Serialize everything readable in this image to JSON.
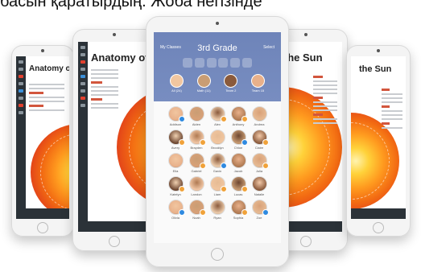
{
  "caption": "басын қаратырдың. Жоба негізінде",
  "left_book": {
    "title": "Anatomy of the"
  },
  "right_book": {
    "title": "of the Sun"
  },
  "far_left_book": {
    "title": "Anatomy of the"
  },
  "far_right_book": {
    "title": "the Sun"
  },
  "class_app": {
    "back": "My Classes",
    "title": "3rd Grade",
    "select": "Select",
    "groups": [
      "All (24)",
      "Math (11)",
      "Team 2",
      "Team 15"
    ],
    "students": [
      "Addison",
      "Aiden",
      "Alex",
      "Anthony",
      "Andrea",
      "Avery",
      "Brayden",
      "Brooklyn",
      "Chloe",
      "Claire",
      "Ella",
      "Gabriel",
      "Gavin",
      "Jacob",
      "Julia",
      "Katelyn",
      "Landon",
      "Liam",
      "Lucas",
      "Natalie",
      "Olivia",
      "Noah",
      "Ryan",
      "Sophia",
      "Zoe"
    ]
  }
}
